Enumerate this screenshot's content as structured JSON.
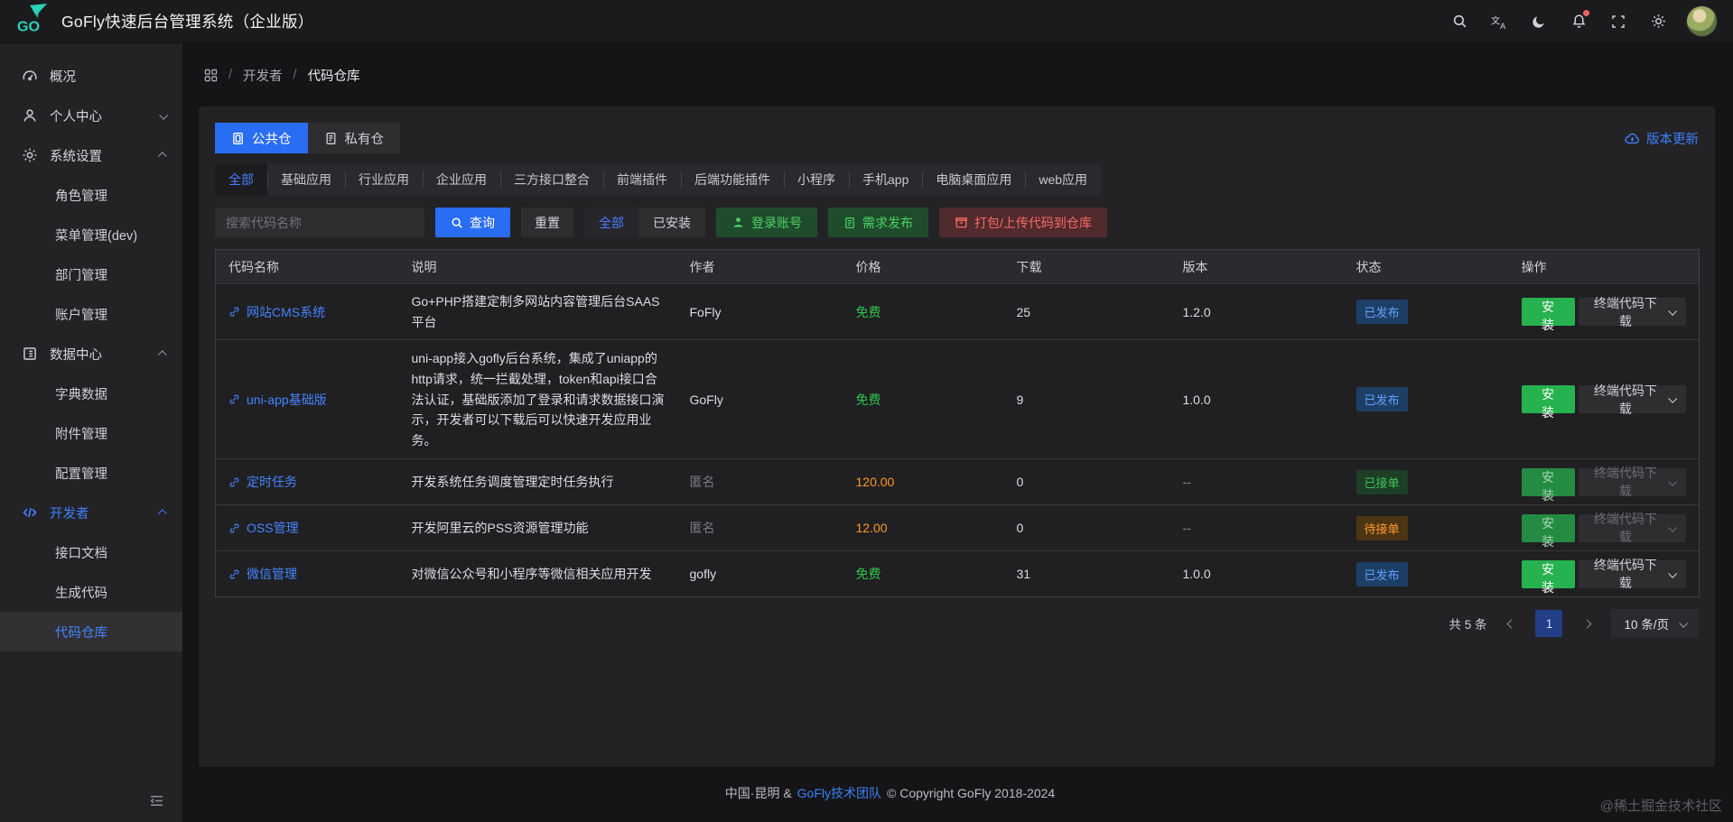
{
  "header": {
    "logo_text": "GO",
    "title": "GoFly快速后台管理系统（企业版）"
  },
  "sidebar": {
    "items": [
      {
        "label": "概况"
      },
      {
        "label": "个人中心"
      },
      {
        "label": "系统设置"
      },
      {
        "label": "角色管理"
      },
      {
        "label": "菜单管理(dev)"
      },
      {
        "label": "部门管理"
      },
      {
        "label": "账户管理"
      },
      {
        "label": "数据中心"
      },
      {
        "label": "字典数据"
      },
      {
        "label": "附件管理"
      },
      {
        "label": "配置管理"
      },
      {
        "label": "开发者"
      },
      {
        "label": "接口文档"
      },
      {
        "label": "生成代码"
      },
      {
        "label": "代码仓库"
      }
    ]
  },
  "breadcrumb": {
    "separator": "/",
    "section": "开发者",
    "current": "代码仓库"
  },
  "toolbar": {
    "tabs": [
      {
        "label": "公共仓"
      },
      {
        "label": "私有仓"
      }
    ],
    "version_update": "版本更新",
    "categories": [
      "全部",
      "基础应用",
      "行业应用",
      "企业应用",
      "三方接口整合",
      "前端插件",
      "后端功能插件",
      "小程序",
      "手机app",
      "电脑桌面应用",
      "web应用"
    ],
    "search_placeholder": "搜索代码名称",
    "query": "查询",
    "reset": "重置",
    "filter_all": "全部",
    "filter_installed": "已安装",
    "login": "登录账号",
    "publish": "需求发布",
    "upload": "打包/上传代码到仓库"
  },
  "table": {
    "headers": [
      "代码名称",
      "说明",
      "作者",
      "价格",
      "下载",
      "版本",
      "状态",
      "操作"
    ],
    "rows": [
      {
        "name": "网站CMS系统",
        "desc": "Go+PHP搭建定制多网站内容管理后台SAAS平台",
        "author": "FoFly",
        "price": "免费",
        "downloads": "25",
        "version": "1.2.0",
        "status": "已发布",
        "install": "安装",
        "download": "终端代码下载"
      },
      {
        "name": "uni-app基础版",
        "desc": "uni-app接入gofly后台系统，集成了uniapp的http请求，统一拦截处理，token和api接口合法认证，基础版添加了登录和请求数据接口演示，开发者可以下载后可以快速开发应用业务。",
        "author": "GoFly",
        "price": "免费",
        "downloads": "9",
        "version": "1.0.0",
        "status": "已发布",
        "install": "安装",
        "download": "终端代码下载"
      },
      {
        "name": "定时任务",
        "desc": "开发系统任务调度管理定时任务执行",
        "author": "匿名",
        "price": "120.00",
        "downloads": "0",
        "version": "--",
        "status": "已接单",
        "install": "安装",
        "download": "终端代码下载"
      },
      {
        "name": "OSS管理",
        "desc": "开发阿里云的PSS资源管理功能",
        "author": "匿名",
        "price": "12.00",
        "downloads": "0",
        "version": "--",
        "status": "待接单",
        "install": "安装",
        "download": "终端代码下载"
      },
      {
        "name": "微信管理",
        "desc": "对微信公众号和小程序等微信相关应用开发",
        "author": "gofly",
        "price": "免费",
        "downloads": "31",
        "version": "1.0.0",
        "status": "已发布",
        "install": "安装",
        "download": "终端代码下载"
      }
    ]
  },
  "pagination": {
    "total": "共 5 条",
    "page": "1",
    "page_size": "10 条/页"
  },
  "footer": {
    "part1": "中国·昆明 &",
    "team": "GoFly技术团队",
    "part2": "© Copyright GoFly 2018-2024"
  },
  "watermark": "@稀土掘金技术社区",
  "colors": {
    "accent": "#2a6df5",
    "link_blue": "#4584ff",
    "green": "#2fc24a",
    "orange": "#ff9626",
    "red": "#f76a66",
    "teal": "#27d3b9"
  }
}
